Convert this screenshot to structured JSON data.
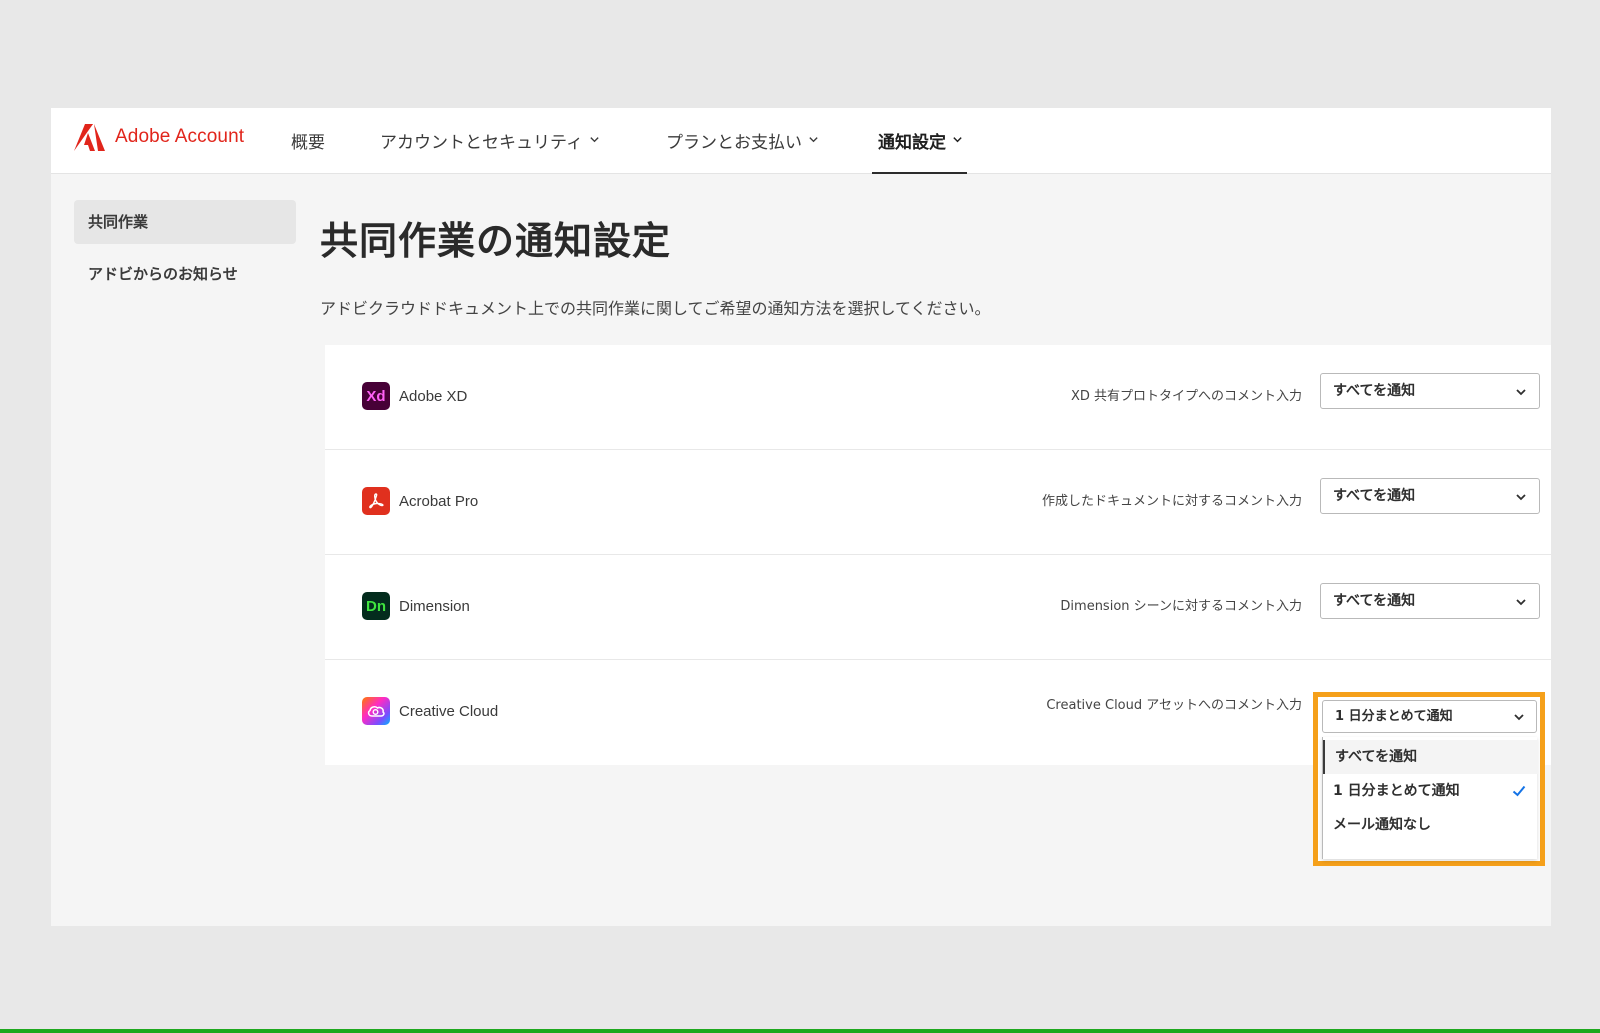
{
  "brand": {
    "name": "Adobe Account",
    "color": "#e1251b"
  },
  "nav": {
    "items": [
      {
        "label": "概要"
      },
      {
        "label": "アカウントとセキュリティ"
      },
      {
        "label": "プランとお支払い"
      },
      {
        "label": "通知設定"
      }
    ],
    "active": "通知設定"
  },
  "sidebar": {
    "items": [
      {
        "label": "共同作業"
      },
      {
        "label": "アドビからのお知らせ"
      }
    ],
    "selected": "共同作業"
  },
  "main": {
    "title": "共同作業の通知設定",
    "description": "アドビクラウドドキュメント上での共同作業に関してご希望の通知方法を選択してください。",
    "rows": [
      {
        "app": "Adobe XD",
        "icon_text": "Xd",
        "icon": "adobe-xd-icon",
        "label": "XD 共有プロトタイプへのコメント入力",
        "value": "すべてを通知"
      },
      {
        "app": "Acrobat Pro",
        "icon_text": "",
        "icon": "acrobat-pro-icon",
        "label": "作成したドキュメントに対するコメント入力",
        "value": "すべてを通知"
      },
      {
        "app": "Dimension",
        "icon_text": "Dn",
        "icon": "dimension-icon",
        "label": "Dimension シーンに対するコメント入力",
        "value": "すべてを通知"
      },
      {
        "app": "Creative Cloud",
        "icon_text": "",
        "icon": "creative-cloud-icon",
        "label": "Creative Cloud アセットへのコメント入力",
        "value": "1 日分まとめて通知"
      }
    ]
  },
  "dropdown": {
    "value": "1 日分まとめて通知",
    "options": [
      {
        "label": "すべてを通知"
      },
      {
        "label": "1 日分まとめて通知"
      },
      {
        "label": "メール通知なし"
      }
    ],
    "selected_option": "1 日分まとめて通知",
    "highlight_color": "#f5a01a",
    "check_color": "#1473e6"
  }
}
